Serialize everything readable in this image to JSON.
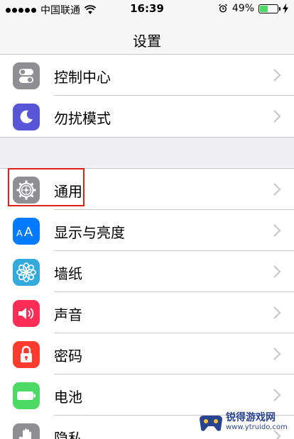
{
  "status_bar": {
    "carrier": "中国联通",
    "time": "16:39",
    "battery_percent": "49%",
    "battery_level": 0.49
  },
  "nav": {
    "title": "设置"
  },
  "groups": [
    {
      "items": [
        {
          "label": "控制中心",
          "icon": "switches-icon",
          "color": "#8e8e93"
        },
        {
          "label": "勿扰模式",
          "icon": "moon-icon",
          "color": "#5856d6"
        }
      ]
    },
    {
      "items": [
        {
          "label": "通用",
          "icon": "gear-icon",
          "color": "#8e8e93"
        },
        {
          "label": "显示与亮度",
          "icon": "text-size-icon",
          "color": "#007aff"
        },
        {
          "label": "墙纸",
          "icon": "flower-icon",
          "color": "#34aadc"
        },
        {
          "label": "声音",
          "icon": "speaker-icon",
          "color": "#ff2d55"
        },
        {
          "label": "密码",
          "icon": "lock-icon",
          "color": "#ff3b30"
        },
        {
          "label": "电池",
          "icon": "battery-icon",
          "color": "#4cd964"
        },
        {
          "label": "隐私",
          "icon": "hand-icon",
          "color": "#8e8e93"
        }
      ]
    }
  ],
  "watermark": {
    "main": "锐得游戏网",
    "sub": "www.ytruido.com"
  }
}
